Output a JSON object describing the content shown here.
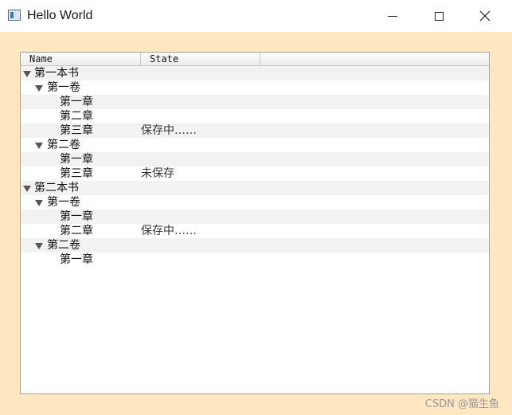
{
  "window": {
    "title": "Hello World",
    "icon": "window-app-icon"
  },
  "tree": {
    "columns": [
      "Name",
      "State"
    ],
    "rows": [
      {
        "level": 0,
        "expanded": true,
        "name": "第一本书",
        "state": ""
      },
      {
        "level": 1,
        "expanded": true,
        "name": "第一卷",
        "state": ""
      },
      {
        "level": 2,
        "name": "第一章",
        "state": ""
      },
      {
        "level": 2,
        "name": "第二章",
        "state": ""
      },
      {
        "level": 2,
        "name": "第三章",
        "state": "保存中……"
      },
      {
        "level": 1,
        "expanded": true,
        "name": "第二卷",
        "state": ""
      },
      {
        "level": 2,
        "name": "第一章",
        "state": ""
      },
      {
        "level": 2,
        "name": "第三章",
        "state": "未保存"
      },
      {
        "level": 0,
        "expanded": true,
        "name": "第二本书",
        "state": ""
      },
      {
        "level": 1,
        "expanded": true,
        "name": "第一卷",
        "state": ""
      },
      {
        "level": 2,
        "name": "第一章",
        "state": ""
      },
      {
        "level": 2,
        "name": "第二章",
        "state": "保存中……"
      },
      {
        "level": 1,
        "expanded": true,
        "name": "第二卷",
        "state": ""
      },
      {
        "level": 2,
        "name": "第一章",
        "state": ""
      }
    ]
  },
  "watermark": "CSDN @猫生鱼",
  "colors": {
    "window_bg": "#ffe7c1",
    "row_alt": "#f2f2f2",
    "titlebar": "#ffffff"
  }
}
